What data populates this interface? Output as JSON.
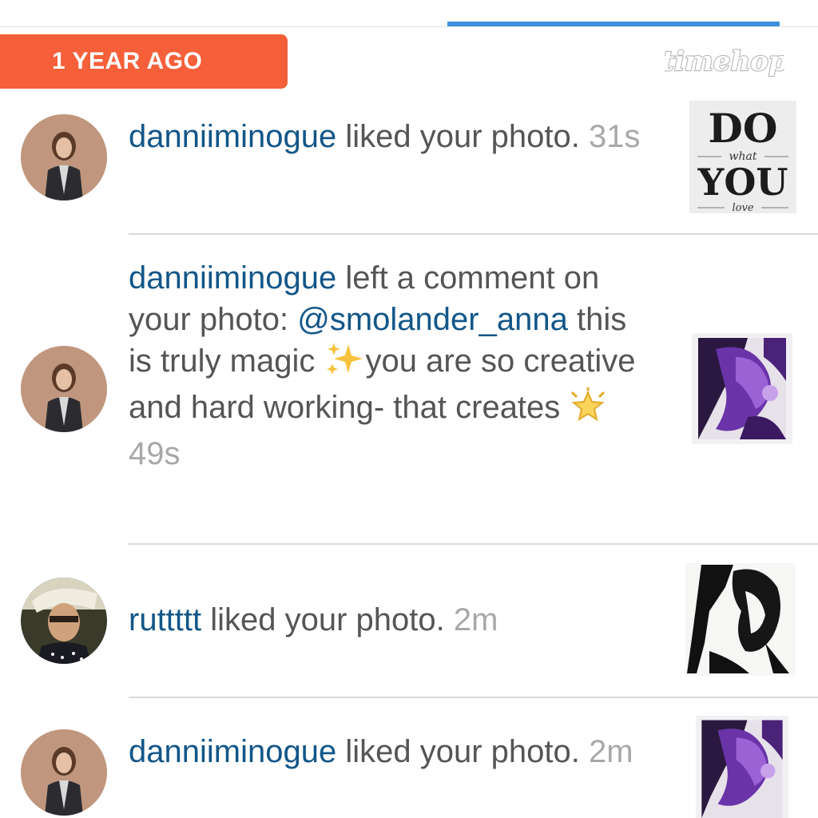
{
  "header": {
    "badge_text": "1 YEAR AGO",
    "logo_text": "timehop"
  },
  "colors": {
    "badge": "#f5603a",
    "tab_indicator": "#3f8fdc",
    "username": "#125688",
    "body_text": "#555555",
    "timestamp": "#a8a8a8"
  },
  "notifications": [
    {
      "username": "danniiminogue",
      "action": " liked your photo.",
      "time": "31s",
      "avatar_icon": "woman-blazer-avatar",
      "thumbnail_icon": "do-what-you-love-poster",
      "poster": {
        "line1": "DO",
        "line2": "what",
        "line3": "YOU",
        "line4": "love"
      }
    },
    {
      "username": "danniiminogue",
      "action": " left a comment on your photo: ",
      "mention": "@smolander_anna",
      "comment_part1": " this is truly magic ",
      "comment_part2": "you are so creative and hard working- that creates ",
      "emoji1": "sparkles-emoji",
      "emoji2": "glowing-star-emoji",
      "time": "49s",
      "avatar_icon": "woman-blazer-avatar",
      "thumbnail_icon": "purple-watercolor-art"
    },
    {
      "username": "ruttttt",
      "action": " liked your photo.",
      "time": "2m",
      "avatar_icon": "man-sunglasses-avatar",
      "thumbnail_icon": "black-ink-portrait-art"
    },
    {
      "username": "danniiminogue",
      "action": " liked your photo.",
      "time": "2m",
      "avatar_icon": "woman-blazer-avatar",
      "thumbnail_icon": "purple-watercolor-art"
    }
  ]
}
